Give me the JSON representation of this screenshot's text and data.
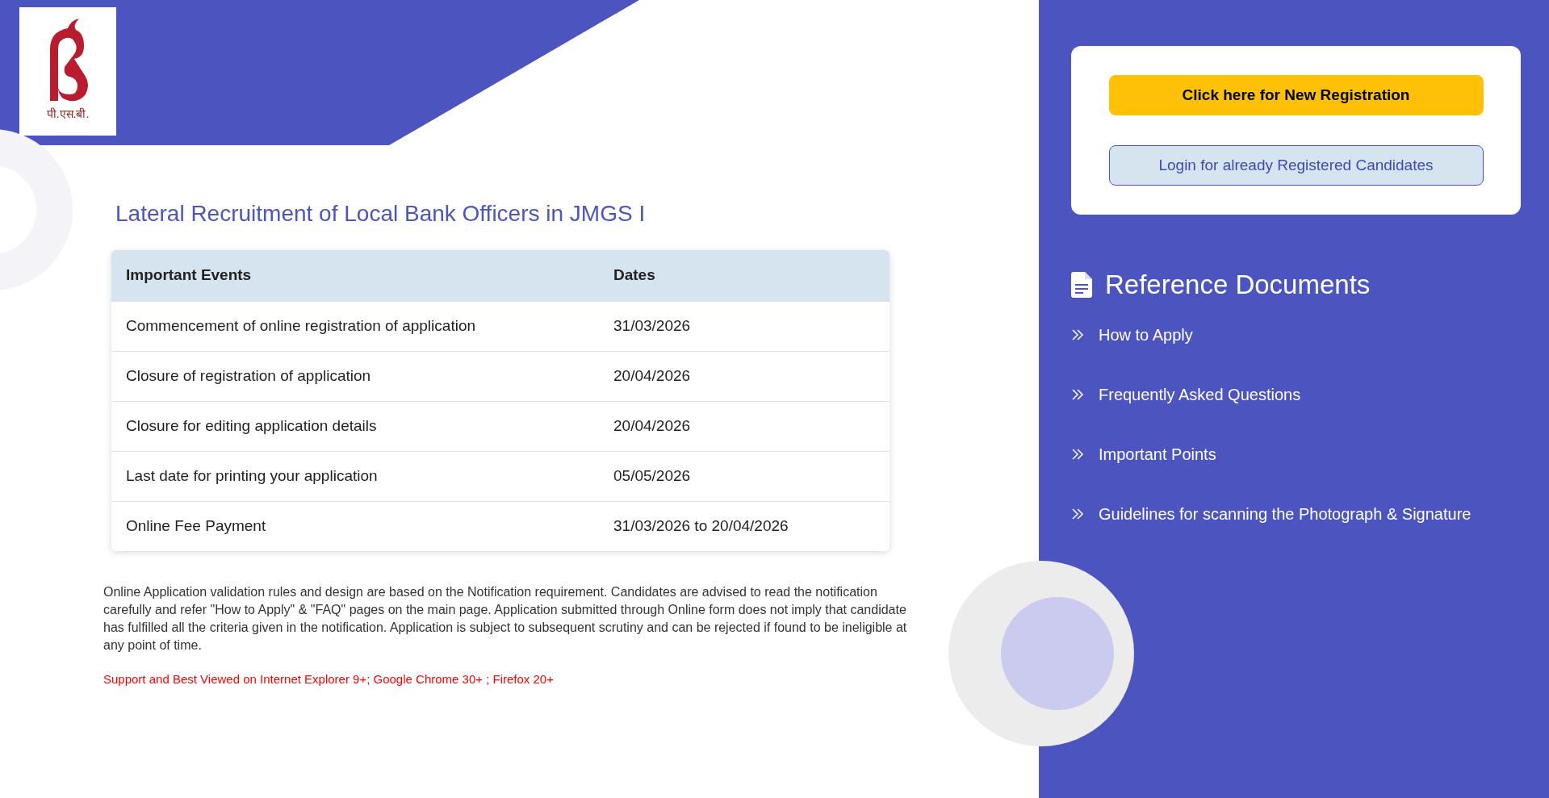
{
  "logo": {
    "caption": "पी.एस.बी."
  },
  "title": "Lateral Recruitment of Local Bank Officers in JMGS I",
  "table": {
    "columns": [
      "Important Events",
      "Dates"
    ],
    "rows": [
      [
        "Commencement of online registration of application",
        "31/03/2026"
      ],
      [
        "Closure of registration of application",
        "20/04/2026"
      ],
      [
        "Closure for editing application details",
        "20/04/2026"
      ],
      [
        "Last date for printing your application",
        "05/05/2026"
      ],
      [
        "Online Fee Payment",
        "31/03/2026 to 20/04/2026"
      ]
    ]
  },
  "notice": "Online Application validation rules and design are based on the Notification requirement. Candidates are advised to read the notification carefully and refer \"How to Apply\" & \"FAQ\" pages on the main page. Application submitted through Online form does not imply that candidate has fulfilled all the criteria given in the notification. Application is subject to subsequent scrutiny and can be rejected if found to be ineligible at any point of time.",
  "browser_note": "Support and Best Viewed on Internet Explorer 9+; Google Chrome 30+ ; Firefox 20+",
  "actions": [
    {
      "kind": "primary",
      "label": "Click here for New Registration"
    },
    {
      "kind": "secondary",
      "label": "Login for already Registered Candidates"
    }
  ],
  "reference": {
    "heading": "Reference Documents",
    "links": [
      "How to Apply",
      "Frequently Asked Questions",
      "Important Points",
      "Guidelines for scanning the Photograph & Signature"
    ]
  }
}
